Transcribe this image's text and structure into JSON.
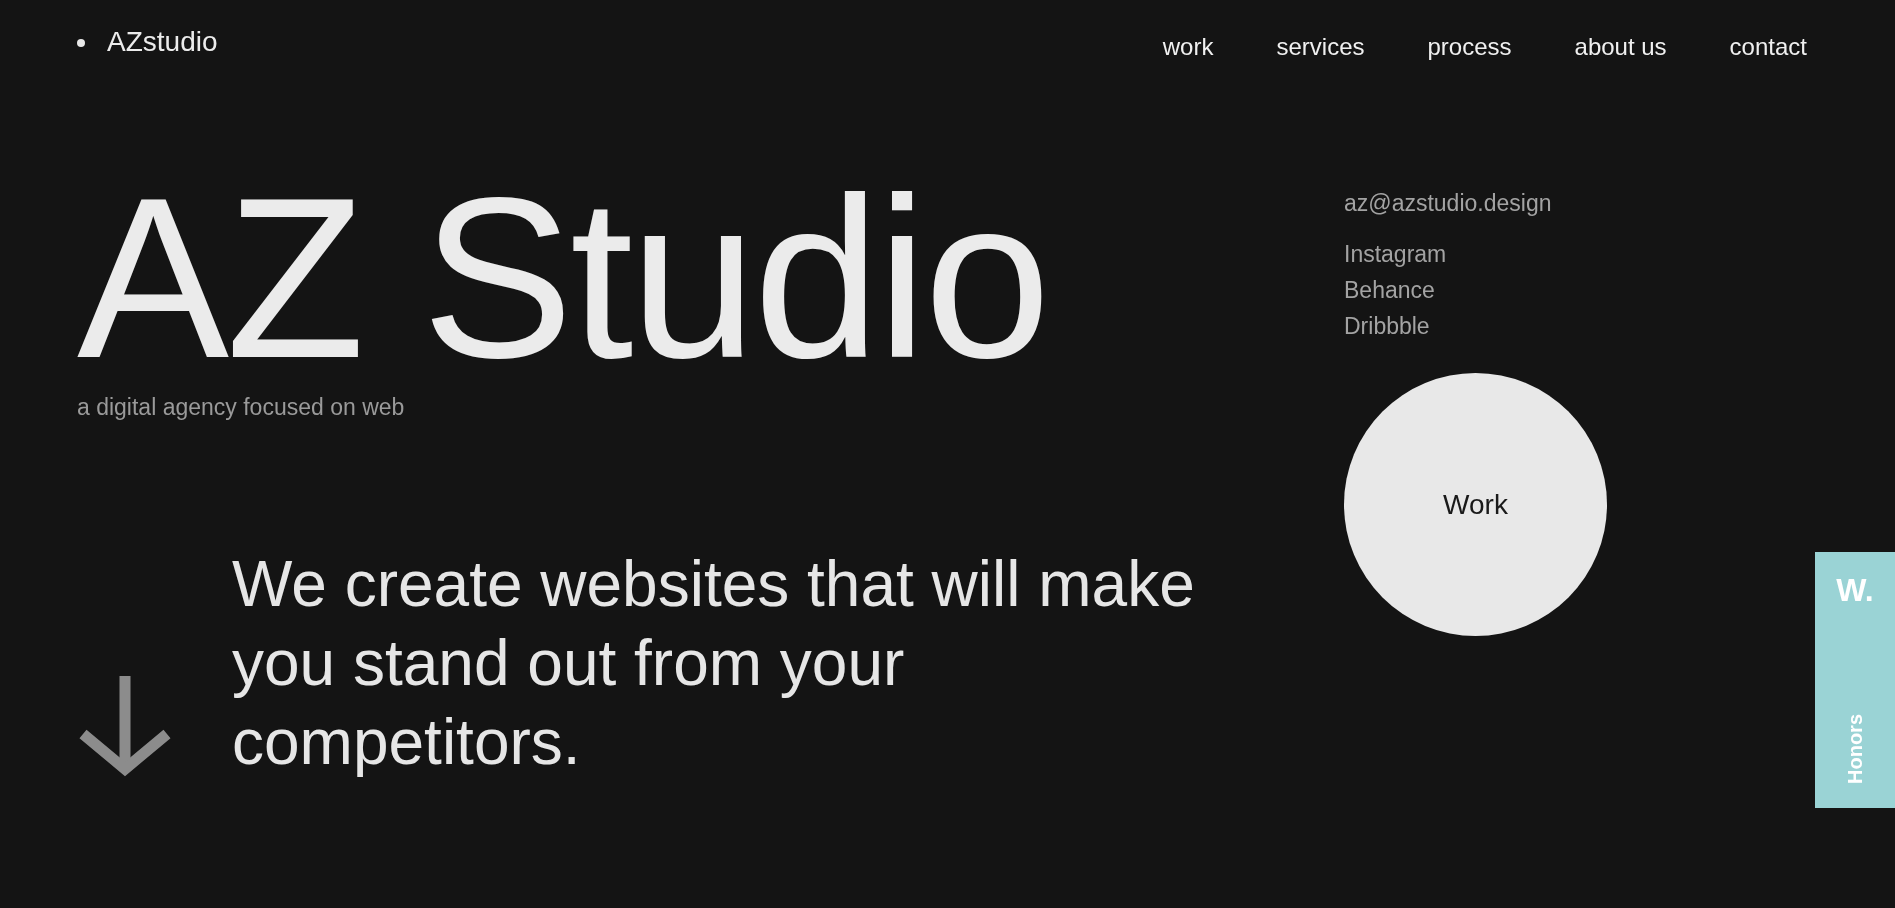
{
  "header": {
    "logo": "AZstudio",
    "nav": [
      "work",
      "services",
      "process",
      "about us",
      "contact"
    ]
  },
  "hero": {
    "title": "AZ Studio",
    "subtitle": "a digital agency focused on web",
    "tagline": "We create websites that will make you stand out from your competitors."
  },
  "contact": {
    "email": "az@azstudio.design",
    "social_links": [
      "Instagram",
      "Behance",
      "Dribbble"
    ],
    "work_button": "Work"
  },
  "honors_badge": {
    "logo": "W.",
    "label": "Honors"
  }
}
